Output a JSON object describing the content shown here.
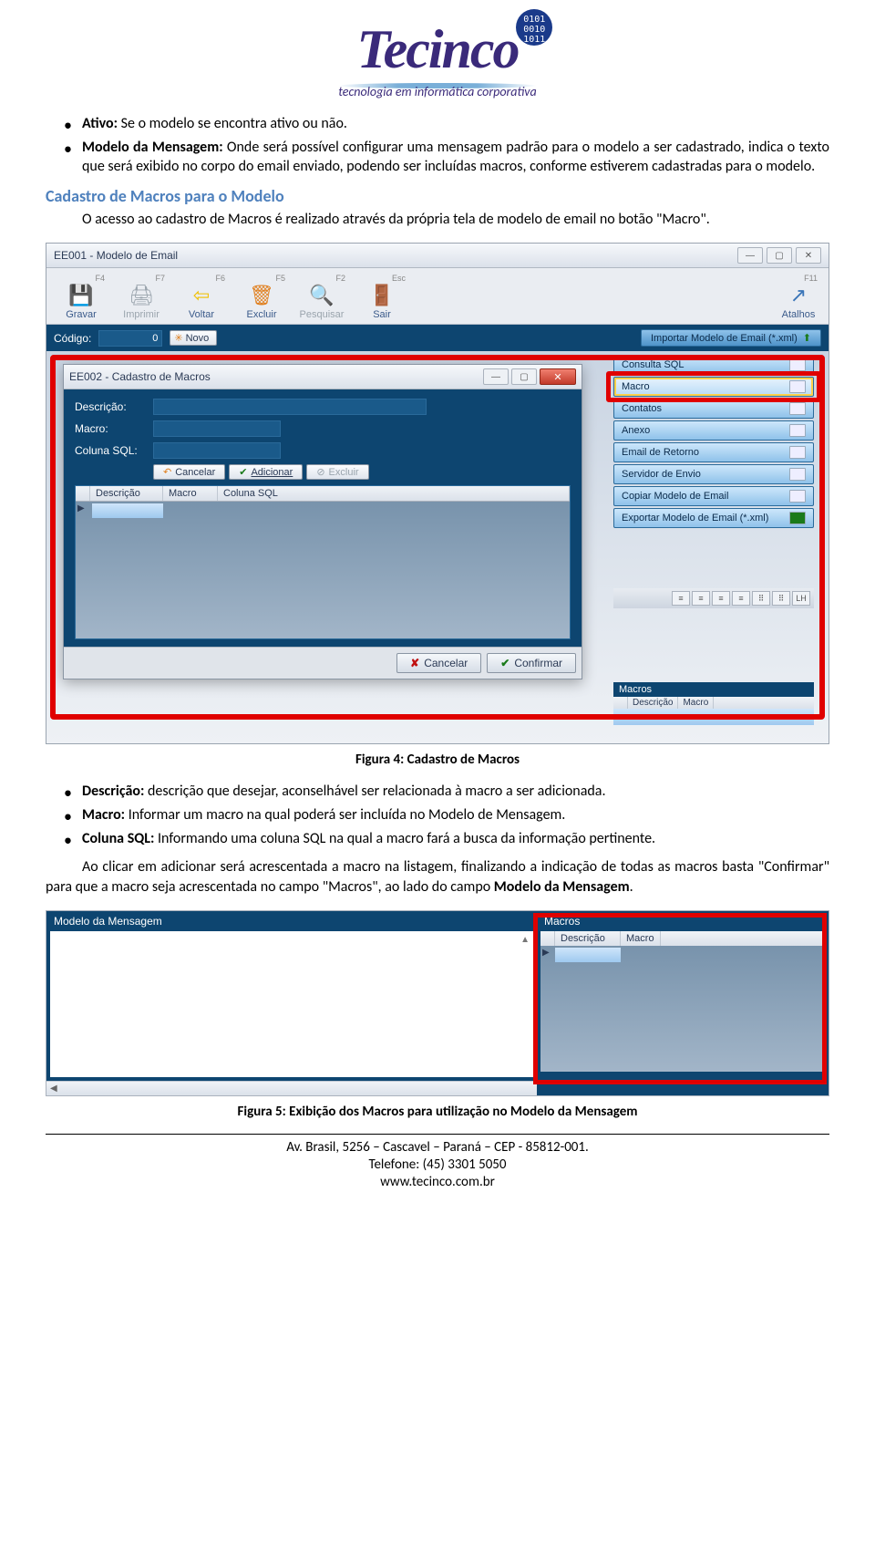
{
  "logo": {
    "main": "Tecinco",
    "tagline": "tecnologia em informática corporativa",
    "globe": "0101\n0010\n1011"
  },
  "intro_bullets": [
    {
      "label": "Ativo:",
      "text": " Se o modelo se encontra ativo ou não."
    },
    {
      "label": "Modelo da Mensagem:",
      "text": " Onde será possível configurar uma mensagem padrão para o modelo a ser cadastrado, indica o texto que será exibido no corpo do email enviado, podendo ser incluídas macros, conforme estiverem cadastradas para o modelo."
    }
  ],
  "heading1": "Cadastro de Macros para o Modelo",
  "para1": "O acesso ao cadastro de Macros é realizado através da própria tela de modelo de email no botão \"Macro\".",
  "screenshot1": {
    "window_title": "EE001 - Modelo de Email",
    "toolbar": [
      {
        "fkey": "F4",
        "label": "Gravar",
        "icon": "💾",
        "color": "#4caf50"
      },
      {
        "fkey": "F7",
        "label": "Imprimir",
        "icon": "🖨",
        "disabled": true
      },
      {
        "fkey": "F6",
        "label": "Voltar",
        "icon": "⬅",
        "color": "#f0c000"
      },
      {
        "fkey": "F5",
        "label": "Excluir",
        "icon": "🗑",
        "color": "#e08020"
      },
      {
        "fkey": "F2",
        "label": "Pesquisar",
        "icon": "🔍",
        "disabled": true
      },
      {
        "fkey": "Esc",
        "label": "Sair",
        "icon": "🚪",
        "color": "#c06010"
      }
    ],
    "atalhos": {
      "fkey": "F11",
      "label": "Atalhos",
      "icon": "↗"
    },
    "codigo_label": "Código:",
    "codigo_value": "0",
    "novo_label": "Novo",
    "import_label": "Importar Modelo de Email (*.xml)",
    "side_menu": [
      "Consulta SQL",
      "Macro",
      "Contatos",
      "Anexo",
      "Email de Retorno",
      "Servidor de Envio",
      "Copiar Modelo de Email",
      "Exportar Modelo de Email (*.xml)"
    ],
    "ee002": {
      "title": "EE002 - Cadastro de Macros",
      "fields": {
        "descricao": "Descrição:",
        "macro": "Macro:",
        "coluna_sql": "Coluna SQL:"
      },
      "buttons": {
        "cancelar": "Cancelar",
        "adicionar": "Adicionar",
        "excluir": "Excluir"
      },
      "grid_headers": [
        "Descrição",
        "Macro",
        "Coluna SQL"
      ],
      "footer": {
        "cancelar": "Cancelar",
        "confirmar": "Confirmar"
      }
    },
    "align_lh": "LH",
    "macros_panel": {
      "title": "Macros",
      "headers": [
        "Descrição",
        "Macro"
      ]
    }
  },
  "caption1": "Figura 4: Cadastro de Macros",
  "bullets2": [
    {
      "label": "Descrição:",
      "text": " descrição que desejar, aconselhável ser relacionada à macro a ser adicionada."
    },
    {
      "label": "Macro:",
      "text": " Informar um macro na qual poderá ser incluída no Modelo de Mensagem."
    },
    {
      "label": "Coluna SQL:",
      "text": " Informando uma coluna SQL na qual a macro fará a busca da informação pertinente."
    }
  ],
  "para2_a": "Ao clicar em adicionar será acrescentada a macro na listagem, finalizando a indicação de todas as macros basta \"Confirmar\" para que a macro seja acrescentada no campo \"Macros\", ao lado do campo ",
  "para2_b": "Modelo da Mensagem",
  "para2_c": ".",
  "screenshot2": {
    "left_title": "Modelo da Mensagem",
    "right_title": "Macros",
    "right_headers": [
      "Descrição",
      "Macro"
    ]
  },
  "caption2": "Figura 5: Exibição dos Macros para utilização no Modelo da Mensagem",
  "footer": {
    "line1": "Av. Brasil, 5256 – Cascavel – Paraná – CEP - 85812-001.",
    "line2": "Telefone: (45) 3301 5050",
    "line3": "www.tecinco.com.br"
  }
}
